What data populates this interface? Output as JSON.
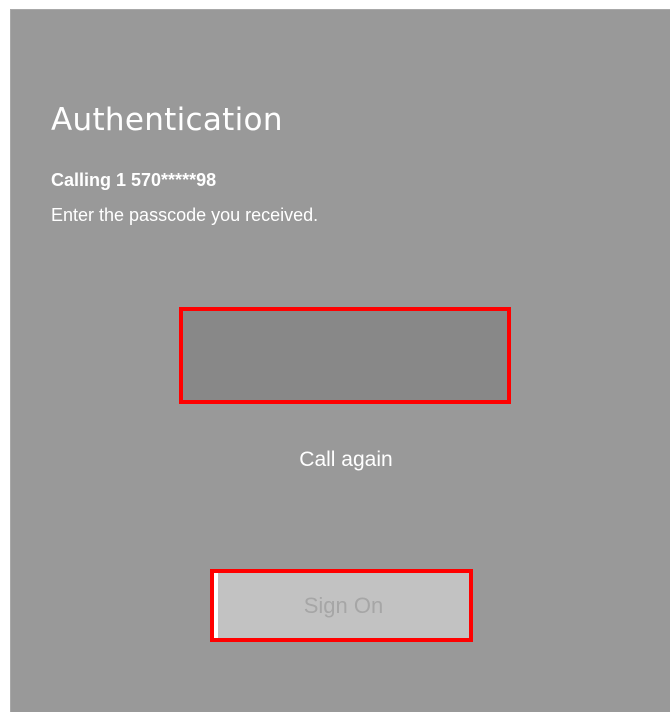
{
  "auth": {
    "title": "Authentication",
    "calling_text": "Calling 1 570*****98",
    "instruction": "Enter the passcode you received.",
    "passcode_value": "",
    "call_again_label": "Call again",
    "sign_on_label": "Sign On"
  },
  "colors": {
    "panel_background": "#999999",
    "input_background": "#888888",
    "highlight_border": "#ff0000",
    "button_background": "#c2c2c2",
    "button_text_disabled": "#a6a6a6",
    "text": "#ffffff"
  }
}
